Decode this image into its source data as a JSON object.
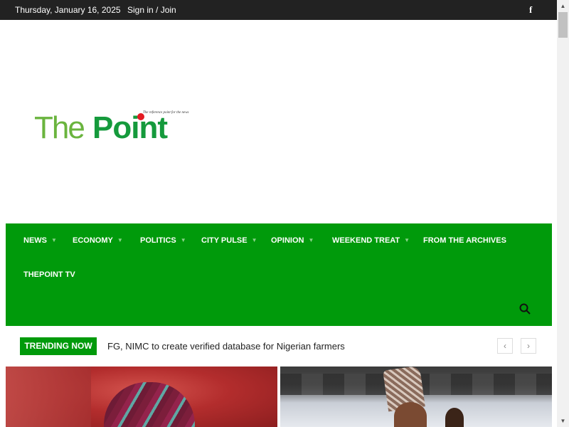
{
  "topbar": {
    "date": "Thursday, January 16, 2025",
    "signin": "Sign in / Join",
    "social_icon": "facebook-icon",
    "social_glyph": "f"
  },
  "logo": {
    "the": "The",
    "point": "Point",
    "tagline": "The reference point for the news"
  },
  "nav": {
    "items": [
      {
        "label": "NEWS"
      },
      {
        "label": "ECONOMY"
      },
      {
        "label": "POLITICS"
      },
      {
        "label": "CITY PULSE"
      },
      {
        "label": "OPINION"
      },
      {
        "label": "WEEKEND TREAT"
      },
      {
        "label": "FROM THE ARCHIVES"
      },
      {
        "label": "THEPOINT TV"
      }
    ],
    "search_icon": "search-icon"
  },
  "trending": {
    "label": "TRENDING NOW",
    "headline": "FG, NIMC to create verified database for Nigerian farmers",
    "prev_glyph": "‹",
    "next_glyph": "›"
  },
  "scrollbar": {
    "up_glyph": "▲",
    "down_glyph": "▼"
  },
  "colors": {
    "topbar": "#222222",
    "nav": "#009a0b",
    "logo_light_green": "#6ab43e",
    "logo_dark_green": "#159a3c",
    "logo_dot": "#e31b23"
  }
}
